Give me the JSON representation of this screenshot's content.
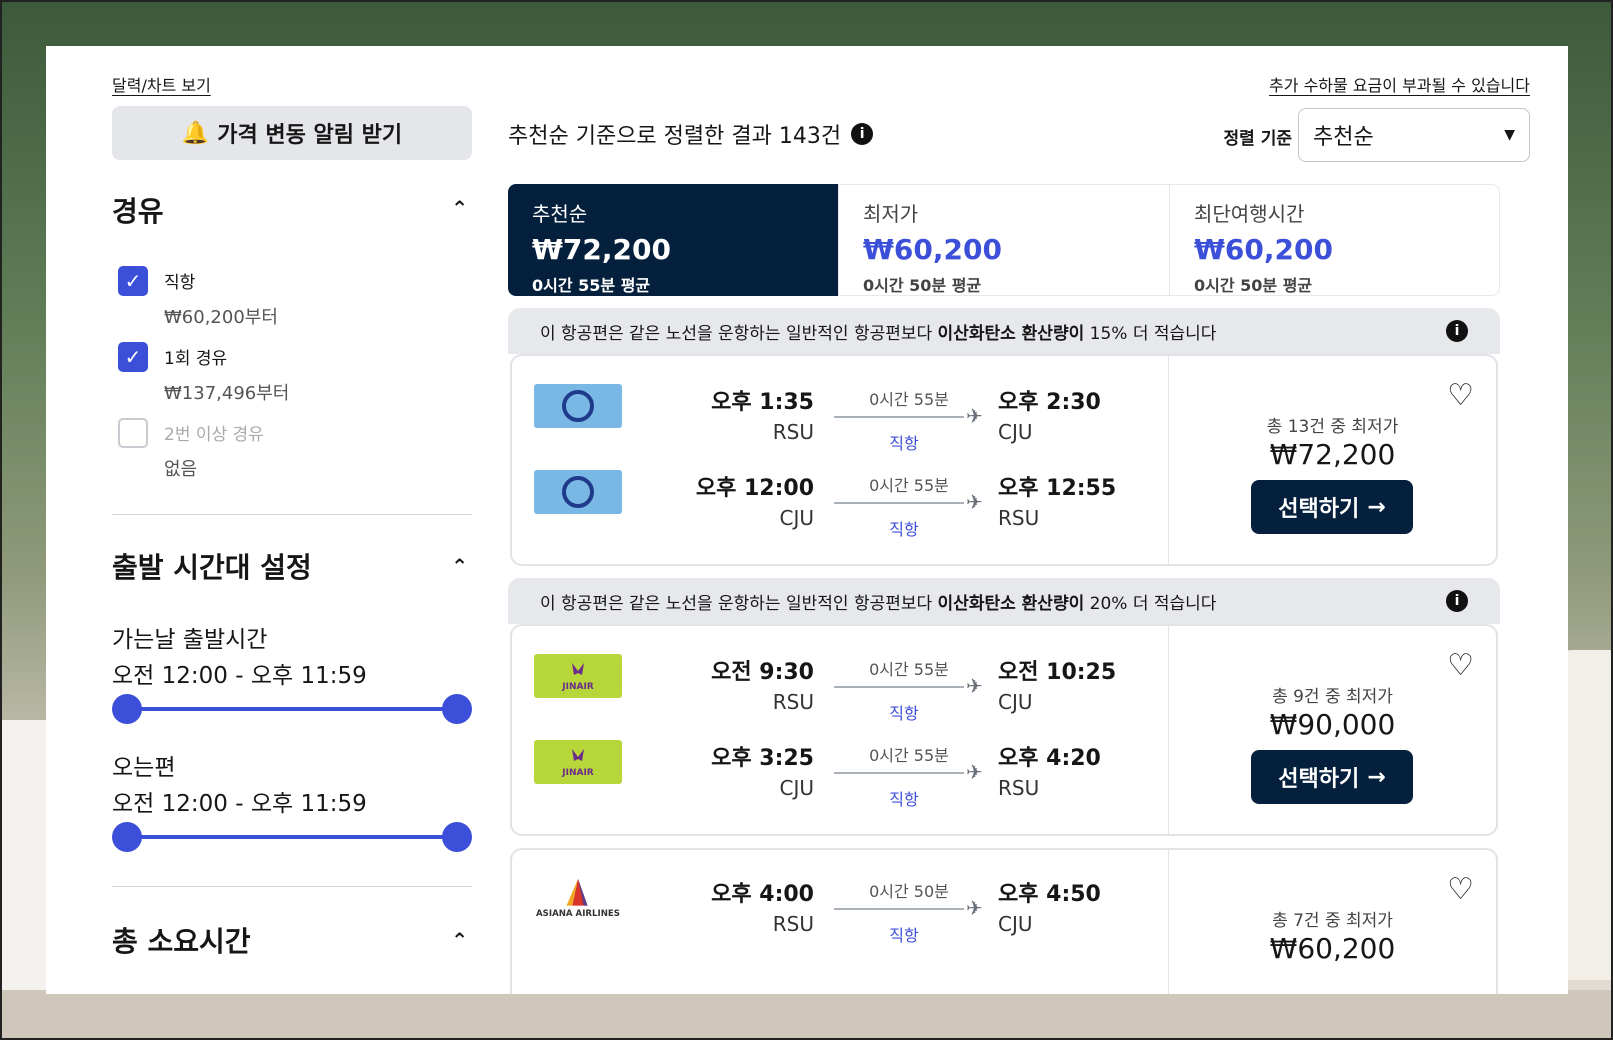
{
  "sidebar": {
    "calendar_link": "달력/차트 보기",
    "alert_button": "가격 변동 알림 받기",
    "stops": {
      "title": "경유",
      "items": [
        {
          "label": "직항",
          "price": "₩60,200부터",
          "checked": true
        },
        {
          "label": "1회 경유",
          "price": "₩137,496부터",
          "checked": true
        },
        {
          "label": "2번 이상 경유",
          "price": "없음",
          "checked": false
        }
      ]
    },
    "departure": {
      "title": "출발 시간대 설정",
      "outbound_label": "가는날 출발시간",
      "outbound_range": "오전 12:00 - 오후 11:59",
      "return_label": "오는편",
      "return_range": "오전 12:00 - 오후 11:59"
    },
    "duration": {
      "title": "총 소요시간"
    }
  },
  "header": {
    "results_text": "추천순 기준으로 정렬한 결과 143건",
    "extra_baggage_link": "추가 수하물 요금이 부과될 수 있습니다",
    "sort_label": "정렬 기준",
    "sort_value": "추천순"
  },
  "tabs": [
    {
      "name": "추천순",
      "price": "₩72,200",
      "sub": "0시간 55분 평균",
      "active": true
    },
    {
      "name": "최저가",
      "price": "₩60,200",
      "sub": "0시간 50분 평균",
      "active": false
    },
    {
      "name": "최단여행시간",
      "price": "₩60,200",
      "sub": "0시간 50분 평균",
      "active": false
    }
  ],
  "results": [
    {
      "eco_prefix": "이 항공편은 같은 노선을 운항하는 일반적인 항공편보다 ",
      "eco_bold": "이산화탄소 환산량이",
      "eco_suffix": " 15% 더 적습니다",
      "airline": "korean",
      "legs": [
        {
          "dep_time": "오후 1:35",
          "dep_code": "RSU",
          "duration": "0시간 55분",
          "stops": "직항",
          "arr_time": "오후 2:30",
          "arr_code": "CJU"
        },
        {
          "dep_time": "오후 12:00",
          "dep_code": "CJU",
          "duration": "0시간 55분",
          "stops": "직항",
          "arr_time": "오후 12:55",
          "arr_code": "RSU"
        }
      ],
      "caption": "총 13건 중 최저가",
      "price": "₩72,200",
      "button": "선택하기"
    },
    {
      "eco_prefix": "이 항공편은 같은 노선을 운항하는 일반적인 항공편보다 ",
      "eco_bold": "이산화탄소 환산량이",
      "eco_suffix": " 20% 더 적습니다",
      "airline": "jinair",
      "logo_text": "JINAIR",
      "legs": [
        {
          "dep_time": "오전 9:30",
          "dep_code": "RSU",
          "duration": "0시간 55분",
          "stops": "직항",
          "arr_time": "오전 10:25",
          "arr_code": "CJU"
        },
        {
          "dep_time": "오후 3:25",
          "dep_code": "CJU",
          "duration": "0시간 55분",
          "stops": "직항",
          "arr_time": "오후 4:20",
          "arr_code": "RSU"
        }
      ],
      "caption": "총 9건 중 최저가",
      "price": "₩90,000",
      "button": "선택하기"
    },
    {
      "airline": "asiana",
      "logo_text": "ASIANA AIRLINES",
      "legs": [
        {
          "dep_time": "오후 4:00",
          "dep_code": "RSU",
          "duration": "0시간 50분",
          "stops": "직항",
          "arr_time": "오후 4:50",
          "arr_code": "CJU"
        }
      ],
      "caption": "총 7건 중 최저가",
      "price": "₩60,200"
    }
  ],
  "colors": {
    "accent": "#3c4fd9",
    "navy": "#05203c",
    "eco_bg": "#e6e8ec"
  }
}
